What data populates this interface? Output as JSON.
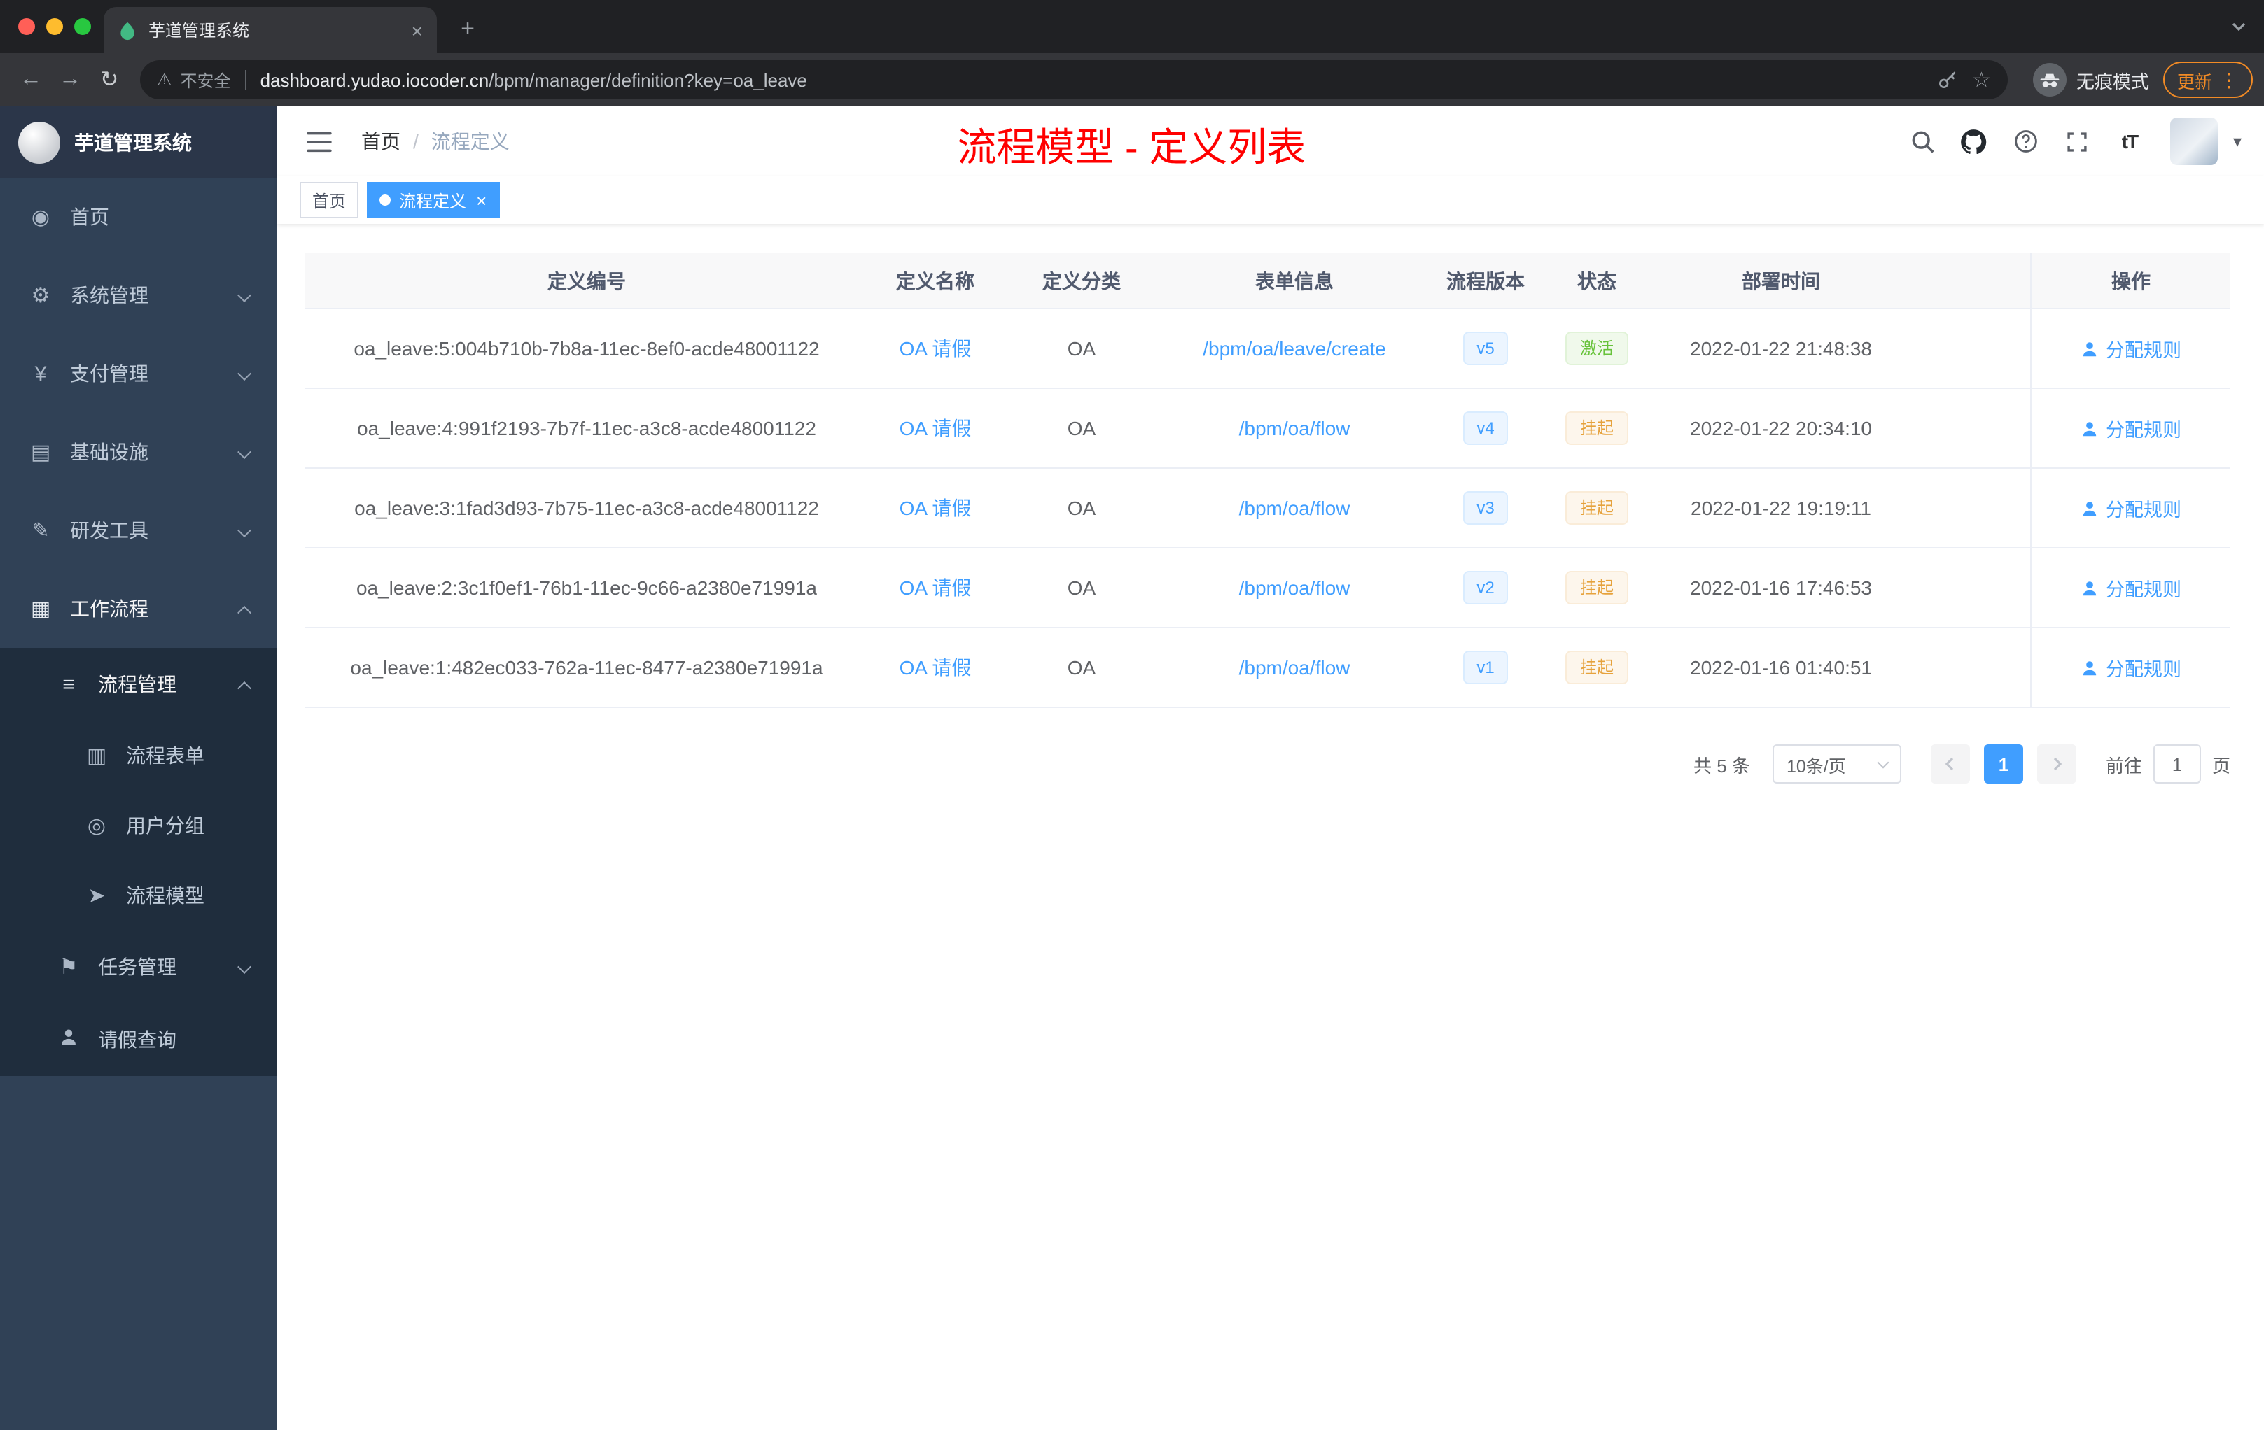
{
  "colors": {
    "accent": "#409eff",
    "success": "#67c23a",
    "warning": "#e6a23c",
    "annotation_red": "#ff0000",
    "sidebar_bg": "#304156",
    "submenu_bg": "#1f2d3d"
  },
  "browser": {
    "tab": {
      "title": "芋道管理系统",
      "favicon": "leaf-icon"
    },
    "address_bar": {
      "security_label": "不安全",
      "domain": "dashboard.yudao.iocoder.cn",
      "path": "/bpm/manager/definition?key=oa_leave"
    },
    "incognito_label": "无痕模式",
    "update_label": "更新"
  },
  "sidebar": {
    "logo_title": "芋道管理系统",
    "items": [
      {
        "label": "首页",
        "icon": "dashboard-icon",
        "level": 1
      },
      {
        "label": "系统管理",
        "icon": "gear-icon",
        "arrow": "down",
        "level": 1
      },
      {
        "label": "支付管理",
        "icon": "yen-icon",
        "arrow": "down",
        "level": 1
      },
      {
        "label": "基础设施",
        "icon": "monitor-icon",
        "arrow": "down",
        "level": 1
      },
      {
        "label": "研发工具",
        "icon": "tools-icon",
        "arrow": "down",
        "level": 1
      },
      {
        "label": "工作流程",
        "icon": "briefcase-icon",
        "arrow": "up",
        "expanded": true,
        "level": 1
      },
      {
        "label": "流程管理",
        "icon": "list-icon",
        "arrow": "up",
        "expanded": true,
        "level": 2
      },
      {
        "label": "流程表单",
        "icon": "form-icon",
        "level": 3
      },
      {
        "label": "用户分组",
        "icon": "users-icon",
        "level": 3
      },
      {
        "label": "流程模型",
        "icon": "send-icon",
        "level": 3
      },
      {
        "label": "任务管理",
        "icon": "flag-icon",
        "arrow": "down",
        "level": 2
      },
      {
        "label": "请假查询",
        "icon": "person-icon",
        "level": 2
      }
    ]
  },
  "header": {
    "breadcrumb": {
      "home": "首页",
      "separator": "/",
      "current": "流程定义"
    },
    "annotation": "流程模型 - 定义列表"
  },
  "tags": [
    {
      "label": "首页",
      "active": false
    },
    {
      "label": "流程定义",
      "active": true,
      "closable": true
    }
  ],
  "table": {
    "columns": [
      "定义编号",
      "定义名称",
      "定义分类",
      "表单信息",
      "流程版本",
      "状态",
      "部署时间",
      "操作"
    ],
    "rows": [
      {
        "id": "oa_leave:5:004b710b-7b8a-11ec-8ef0-acde48001122",
        "name": "OA 请假",
        "category": "OA",
        "form": "/bpm/oa/leave/create",
        "version": "v5",
        "status": "激活",
        "status_type": "success",
        "deploy_time": "2022-01-22 21:48:38",
        "action": "分配规则"
      },
      {
        "id": "oa_leave:4:991f2193-7b7f-11ec-a3c8-acde48001122",
        "name": "OA 请假",
        "category": "OA",
        "form": "/bpm/oa/flow",
        "version": "v4",
        "status": "挂起",
        "status_type": "warning",
        "deploy_time": "2022-01-22 20:34:10",
        "action": "分配规则"
      },
      {
        "id": "oa_leave:3:1fad3d93-7b75-11ec-a3c8-acde48001122",
        "name": "OA 请假",
        "category": "OA",
        "form": "/bpm/oa/flow",
        "version": "v3",
        "status": "挂起",
        "status_type": "warning",
        "deploy_time": "2022-01-22 19:19:11",
        "action": "分配规则"
      },
      {
        "id": "oa_leave:2:3c1f0ef1-76b1-11ec-9c66-a2380e71991a",
        "name": "OA 请假",
        "category": "OA",
        "form": "/bpm/oa/flow",
        "version": "v2",
        "status": "挂起",
        "status_type": "warning",
        "deploy_time": "2022-01-16 17:46:53",
        "action": "分配规则"
      },
      {
        "id": "oa_leave:1:482ec033-762a-11ec-8477-a2380e71991a",
        "name": "OA 请假",
        "category": "OA",
        "form": "/bpm/oa/flow",
        "version": "v1",
        "status": "挂起",
        "status_type": "warning",
        "deploy_time": "2022-01-16 01:40:51",
        "action": "分配规则"
      }
    ]
  },
  "pagination": {
    "total_label": "共 5 条",
    "page_size": "10条/页",
    "current_page": "1",
    "goto_label": "前往",
    "goto_value": "1",
    "page_unit_label": "页"
  }
}
